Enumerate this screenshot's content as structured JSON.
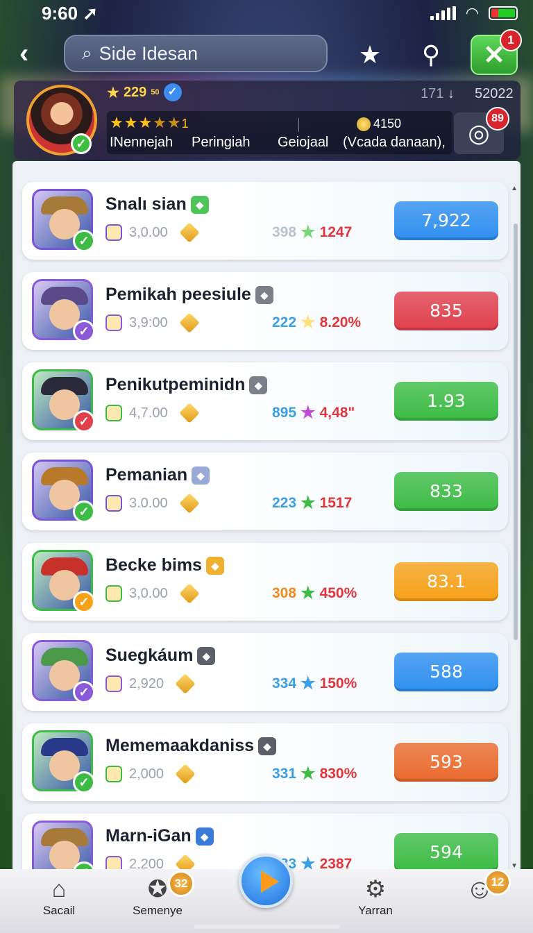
{
  "status": {
    "time": "9:60"
  },
  "search": {
    "value": "Side Idesan"
  },
  "close_badge": "1",
  "profile": {
    "score": "229",
    "score_suffix": "50",
    "right_stat_a": "171",
    "right_stat_sep": "↓",
    "right_stat_b": "52022",
    "stars_suffix": "1",
    "labels": [
      "INennejah",
      "Peringiah",
      "Geiojaal",
      "(Vcada danaan),"
    ],
    "coins": "4150",
    "target_badge": "89"
  },
  "colors": {
    "blue": "#2f8ff0",
    "red": "#e0404c",
    "green": "#3cbc44",
    "orange": "#f7a118",
    "dark_orange": "#ea6a2c"
  },
  "rows": [
    {
      "name": "Snalı sian",
      "sub": "3,0.00",
      "count": "398",
      "pct": "1247",
      "cta": "7,922",
      "cta_color": "blue",
      "frame": "#7a54d8",
      "hat": "#a87a3a",
      "check": "#3cbc44",
      "badge": "#4ec45a",
      "star": "#7ad67a",
      "count_color": "#b9c2cc"
    },
    {
      "name": "Pemikah peesiule",
      "sub": "3,9:00",
      "count": "222",
      "pct": "8.20%",
      "cta": "835",
      "cta_color": "red",
      "frame": "#8a5ad8",
      "hat": "#5a4a8a",
      "check": "#8a5ad8",
      "badge": "#7a7f88",
      "star": "#ffe07a",
      "count_color": "#3aa0e6"
    },
    {
      "name": "Penikutpeminidn",
      "sub": "4,7.00",
      "count": "895",
      "pct": "4,48\"",
      "cta": "1.93",
      "cta_color": "green",
      "frame": "#3cbc44",
      "hat": "#2a2a3a",
      "check": "#e0404c",
      "badge": "#7a7f88",
      "star": "#c04ad8",
      "count_color": "#3aa0e6"
    },
    {
      "name": "Pemanian",
      "sub": "3.0.00",
      "count": "223",
      "pct": "1517",
      "cta": "833",
      "cta_color": "green",
      "frame": "#7a54d8",
      "hat": "#b87a2a",
      "check": "#3cbc44",
      "badge": "#9aaad8",
      "star": "#3cbc44",
      "count_color": "#3aa0e6"
    },
    {
      "name": "Becke bims",
      "sub": "3,0.00",
      "count": "308",
      "pct": "450%",
      "cta": "83.1",
      "cta_color": "orange",
      "frame": "#3cbc44",
      "hat": "#c8302a",
      "check": "#f7a118",
      "badge": "#f0b030",
      "star": "#3cbc44",
      "count_color": "#f08a1c"
    },
    {
      "name": "Suegkáum",
      "sub": "2,920",
      "count": "334",
      "pct": "150%",
      "cta": "588",
      "cta_color": "blue",
      "frame": "#8a5ad8",
      "hat": "#4a9a4a",
      "check": "#8a5ad8",
      "badge": "#5a5f68",
      "star": "#3aa0e6",
      "count_color": "#3aa0e6"
    },
    {
      "name": "Mememaakdaniss",
      "sub": "2,000",
      "count": "331",
      "pct": "830%",
      "cta": "593",
      "cta_color": "dark_orange",
      "frame": "#3cbc44",
      "hat": "#2a3a8a",
      "check": "#3cbc44",
      "badge": "#5a5f68",
      "star": "#3cbc44",
      "count_color": "#3aa0e6"
    },
    {
      "name": "Marn-iGan",
      "sub": "2,200",
      "count": "383",
      "pct": "2387",
      "cta": "594",
      "cta_color": "green",
      "frame": "#8a5ad8",
      "hat": "#a87a3a",
      "check": "#3cbc44",
      "badge": "#3a7ad8",
      "star": "#3aa0e6",
      "count_color": "#3aa0e6"
    }
  ],
  "tabs": [
    {
      "label": "Sacail",
      "icon": "home-icon"
    },
    {
      "label": "Semenye",
      "icon": "spinner-icon",
      "badge": "32"
    },
    {
      "label": "",
      "icon": "play-icon"
    },
    {
      "label": "Yarran",
      "icon": "gear-icon"
    },
    {
      "label": "",
      "icon": "avatar-icon",
      "badge": "12"
    }
  ]
}
